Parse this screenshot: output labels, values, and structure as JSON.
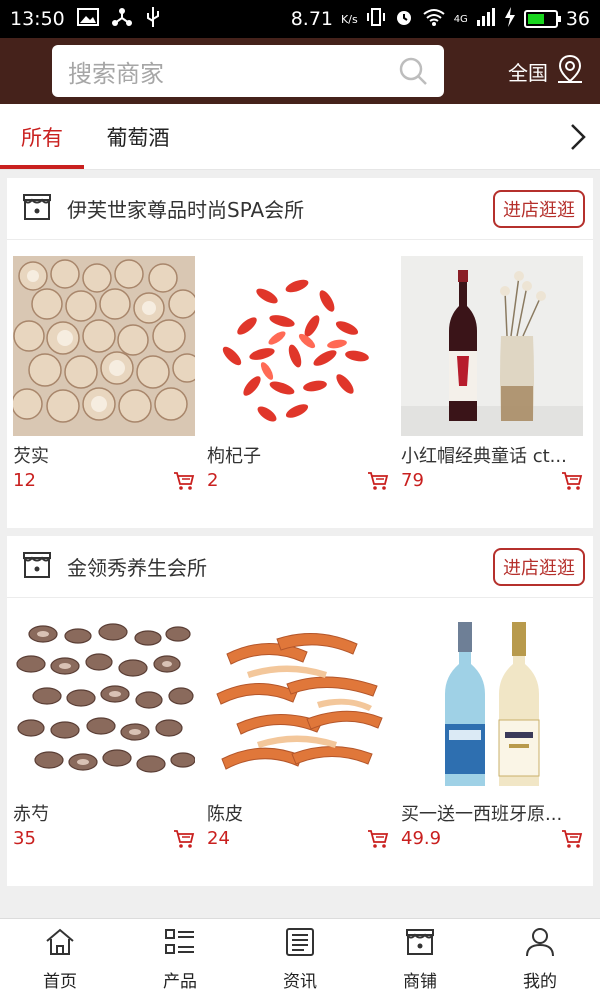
{
  "status_bar": {
    "time": "13:50",
    "speed": "8.71",
    "speed_unit": "K/s",
    "network": "4G",
    "battery": "36"
  },
  "header": {
    "search_placeholder": "搜索商家",
    "region_label": "全国"
  },
  "tabs": [
    {
      "label": "所有",
      "active": true
    },
    {
      "label": "葡萄酒",
      "active": false
    }
  ],
  "shops": [
    {
      "name": "伊芙世家尊品时尚SPA会所",
      "visit_label": "进店逛逛",
      "products": [
        {
          "name": "芡实",
          "price": "12"
        },
        {
          "name": "枸杞子",
          "price": "2"
        },
        {
          "name": "小红帽经典童话 ct...",
          "price": "79"
        }
      ]
    },
    {
      "name": "金领秀养生会所",
      "visit_label": "进店逛逛",
      "products": [
        {
          "name": "赤芍",
          "price": "35"
        },
        {
          "name": "陈皮",
          "price": "24"
        },
        {
          "name": "买一送一西班牙原...",
          "price": "49.9"
        }
      ]
    }
  ],
  "bottom_nav": [
    {
      "label": "首页",
      "icon": "home-icon"
    },
    {
      "label": "产品",
      "icon": "list-icon"
    },
    {
      "label": "资讯",
      "icon": "news-icon"
    },
    {
      "label": "商铺",
      "icon": "store-icon"
    },
    {
      "label": "我的",
      "icon": "user-icon"
    }
  ],
  "colors": {
    "header_bg": "#45221b",
    "accent": "#c9201f",
    "visit_border": "#b5302c"
  }
}
